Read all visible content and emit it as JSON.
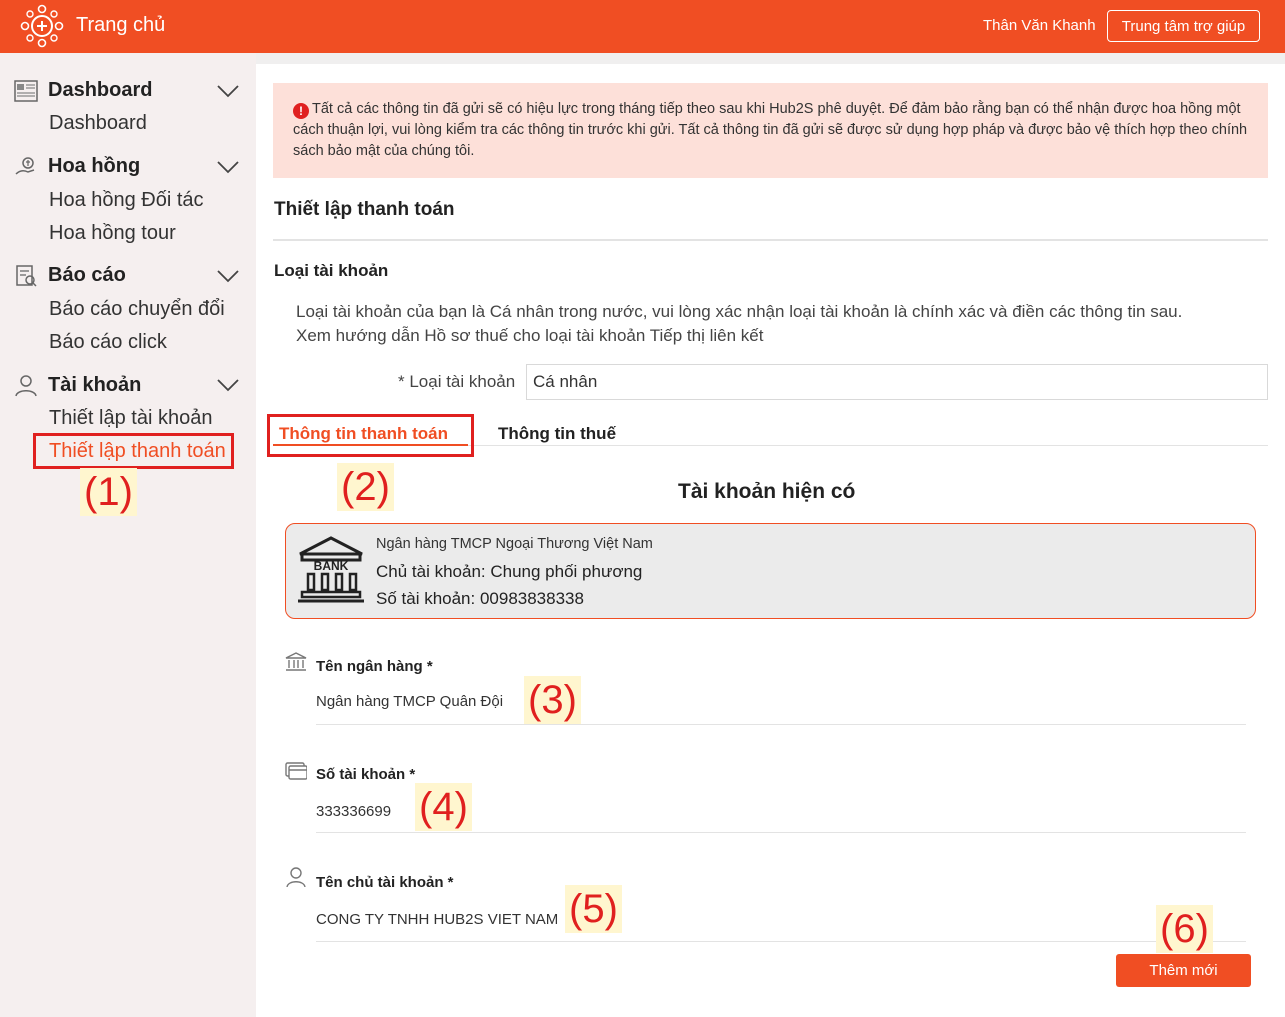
{
  "header": {
    "brand": "Trang chủ",
    "user_name": "Thân Văn Khanh",
    "help_label": "Trung tâm trợ giúp"
  },
  "sidebar": {
    "groups": [
      {
        "label": "Dashboard",
        "icon": "dashboard-icon",
        "items": [
          "Dashboard"
        ]
      },
      {
        "label": "Hoa hồng",
        "icon": "commission-icon",
        "items": [
          "Hoa hồng Đối tác",
          "Hoa hồng tour"
        ]
      },
      {
        "label": "Báo cáo",
        "icon": "report-icon",
        "items": [
          "Báo cáo chuyển đổi",
          "Báo cáo click"
        ]
      },
      {
        "label": "Tài khoản",
        "icon": "user-icon",
        "items": [
          "Thiết lập tài khoản",
          "Thiết lập thanh toán"
        ]
      }
    ],
    "active_item": "Thiết lập thanh toán"
  },
  "annotations": [
    "(1)",
    "(2)",
    "(3)",
    "(4)",
    "(5)",
    "(6)"
  ],
  "main": {
    "alert": "Tất cả các thông tin đã gửi sẽ có hiệu lực trong tháng tiếp theo sau khi Hub2S phê duyệt. Để đảm bảo rằng bạn có thể nhận được hoa hồng một cách thuận lợi, vui lòng kiểm tra các thông tin trước khi gửi. Tất cả thông tin đã gửi sẽ được sử dụng hợp pháp và được bảo vệ thích hợp theo chính sách bảo mật của chúng tôi.",
    "section_title": "Thiết lập thanh toán",
    "account_type_title": "Loại tài khoản",
    "desc_line1": "Loại tài khoản của bạn là Cá nhân trong nước, vui lòng xác nhận loại tài khoản là chính xác và điền các thông tin sau.",
    "desc_line2": "Xem hướng dẫn Hồ sơ thuế cho loại tài khoản Tiếp thị liên kết",
    "account_type_label": "* Loại tài khoản",
    "account_type_value": "Cá nhân",
    "tabs": [
      "Thông tin thanh toán",
      "Thông tin thuế"
    ],
    "existing_title": "Tài khoản hiện có",
    "bank_card": {
      "bank_name": "Ngân hàng TMCP Ngoại Thương Việt Nam",
      "holder": "Chủ tài khoản: Chung phối phương",
      "number": "Số tài khoản: 00983838338",
      "icon_text": "BANK"
    },
    "form": {
      "bank_label": "Tên ngân hàng *",
      "bank_value": "Ngân hàng TMCP Quân Đội",
      "account_label": "Số tài khoản *",
      "account_value": "333336699",
      "holder_label": "Tên chủ tài khoản *",
      "holder_value": "CONG TY TNHH HUB2S VIET NAM"
    },
    "add_button": "Thêm mới"
  },
  "colors": {
    "primary": "#f04e23",
    "annotation": "#e0201f",
    "alert_bg": "#fde0d9"
  }
}
